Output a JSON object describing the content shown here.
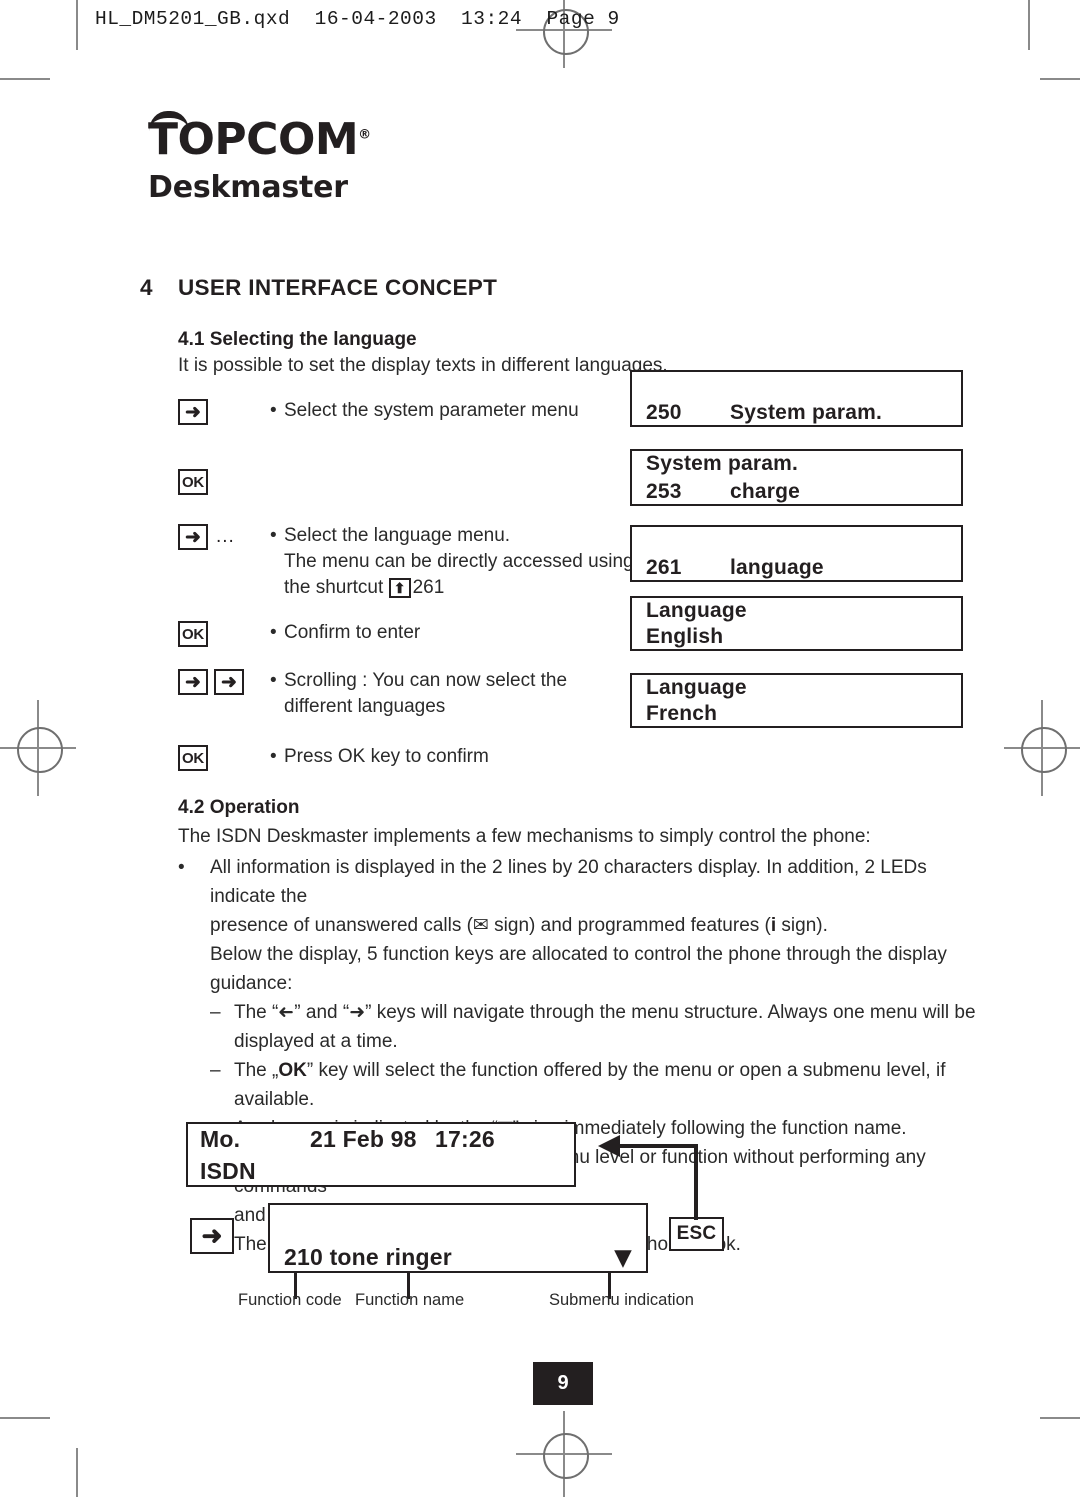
{
  "print_header": "HL_DM5201_GB.qxd  16-04-2003  13:24  Page 9",
  "logo": {
    "brand": "TOPCOM",
    "registered_mark": "®",
    "subtitle": "Deskmaster"
  },
  "section4": {
    "number": "4",
    "title": "USER INTERFACE CONCEPT"
  },
  "section41": {
    "heading": "4.1 Selecting the language",
    "intro": "It is possible to set the display texts in different languages.",
    "steps": [
      {
        "keys": [
          "arrow-right"
        ],
        "trailing": "",
        "lines": [
          "Select the system parameter menu"
        ]
      },
      {
        "keys": [
          "ok"
        ],
        "trailing": "",
        "lines": []
      },
      {
        "keys": [
          "arrow-right"
        ],
        "trailing": "...",
        "lines": [
          "Select the language menu.",
          "The menu can be directly accessed using",
          "the shurtcut"
        ],
        "shortcut_code": "261"
      },
      {
        "keys": [
          "ok"
        ],
        "trailing": "",
        "lines": [
          "Confirm to enter"
        ]
      },
      {
        "keys": [
          "arrow-left",
          "arrow-right"
        ],
        "trailing": "",
        "lines": [
          "Scrolling : You can now select the",
          "different languages"
        ]
      },
      {
        "keys": [
          "ok"
        ],
        "trailing": "",
        "lines": [
          "Press OK key to confirm"
        ]
      }
    ],
    "displays": [
      {
        "line1": "",
        "code": "250",
        "line2": "System param."
      },
      {
        "line1": "System param.",
        "code": "253",
        "line2": "charge"
      },
      {
        "line1": "",
        "code": "261",
        "line2": "language"
      },
      {
        "line1": "Language",
        "code": "",
        "line2": "English"
      },
      {
        "line1": "Language",
        "code": "",
        "line2": "French"
      }
    ]
  },
  "section42": {
    "heading": "4.2 Operation",
    "intro": "The ISDN Deskmaster implements a few mechanisms to simply control the phone:",
    "bullet": {
      "line1": "All information is displayed in the 2 lines by 20 characters display. In addition, 2 LEDs indicate the",
      "line2_a": "presence of unanswered calls (",
      "envelope_sign": "✉",
      "line2_b": " sign) and programmed features (",
      "info_sign": "i",
      "line2_c": " sign).",
      "line3": "Below the display, 5 function keys are allocated to control the phone through the display guidance:"
    },
    "dashes": [
      {
        "a": "The “",
        "glyph1": "➜",
        "b": "” and “",
        "glyph2": "➜",
        "c": "” keys will navigate through the menu structure. Always one menu will be",
        "line2": "displayed at a time."
      },
      {
        "a": "The „",
        "key": "OK",
        "b": "” key will select the function offered by the menu or open a submenu level, if available.",
        "line2_a": "A submenu is indicated by the “",
        "glyph": "▼",
        "line2_b": "” sign immediately following the function name."
      },
      {
        "a": "The „",
        "key": "ESC",
        "b": "” key will leave the current menu level or function without performing any commands",
        "line2": "and return to the previous level."
      },
      {
        "single": "The key will provide direct access to the built-in phone book."
      }
    ]
  },
  "diagram": {
    "idle_display": {
      "day": "Mo.",
      "date": "21 Feb 98",
      "time": "17:26",
      "line2": "ISDN"
    },
    "menu_display": {
      "code": "210",
      "name": "tone ringer",
      "submenu_glyph": "▼"
    },
    "nav_key": "➜",
    "esc_key": "ESC",
    "captions": {
      "function_code": "Function code",
      "function_name": "Function name",
      "submenu_indication": "Submenu indication"
    }
  },
  "footer": {
    "page_number": "9"
  }
}
